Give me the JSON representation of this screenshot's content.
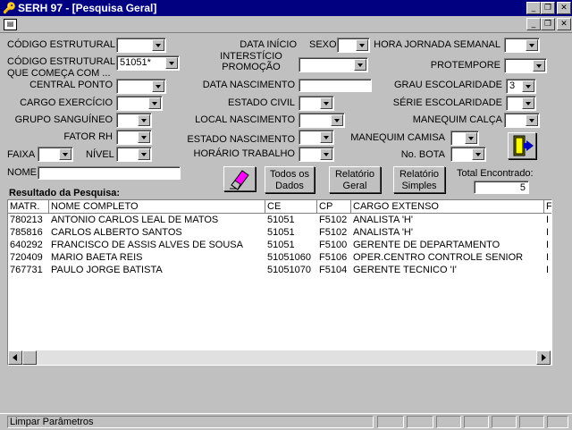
{
  "window": {
    "title": "SERH 97 - [Pesquisa Geral]"
  },
  "form": {
    "codigo_estrutural": {
      "label": "CÓDIGO ESTRUTURAL",
      "value": ""
    },
    "codigo_estrutural_comeca": {
      "label_line1": "CÓDIGO ESTRUTURAL",
      "label_line2": "QUE COMEÇA COM ...",
      "value": "51051*"
    },
    "central_ponto": {
      "label": "CENTRAL PONTO",
      "value": ""
    },
    "cargo_exercicio": {
      "label": "CARGO EXERCÍCIO",
      "value": ""
    },
    "grupo_sanguineo": {
      "label": "GRUPO SANGUÍNEO",
      "value": ""
    },
    "fator_rh": {
      "label": "FATOR RH",
      "value": ""
    },
    "faixa": {
      "label": "FAIXA",
      "value": ""
    },
    "nivel": {
      "label": "NÍVEL",
      "value": ""
    },
    "nome": {
      "label": "NOME",
      "value": ""
    },
    "data_inicio": {
      "label": "DATA INÍCIO"
    },
    "sexo": {
      "label": "SEXO",
      "value": ""
    },
    "intersticio": {
      "label_line1": "INTERSTÍCIO",
      "label_line2": "PROMOÇÃO",
      "value": ""
    },
    "data_nascimento": {
      "label": "DATA NASCIMENTO",
      "value": ""
    },
    "estado_civil": {
      "label": "ESTADO CIVIL",
      "value": ""
    },
    "local_nascimento": {
      "label": "LOCAL NASCIMENTO",
      "value": ""
    },
    "estado_nascimento": {
      "label": "ESTADO NASCIMENTO",
      "value": ""
    },
    "horario_trabalho": {
      "label": "HORÁRIO TRABALHO",
      "value": ""
    },
    "hora_jornada_semanal": {
      "label": "HORA JORNADA SEMANAL",
      "value": ""
    },
    "protempore": {
      "label": "PROTEMPORE",
      "value": ""
    },
    "grau_escolaridade": {
      "label": "GRAU ESCOLARIDADE",
      "value": "3"
    },
    "serie_escolaridade": {
      "label": "SÉRIE ESCOLARIDADE",
      "value": ""
    },
    "manequim_calca": {
      "label": "MANEQUIM CALÇA",
      "value": ""
    },
    "manequim_camisa": {
      "label": "MANEQUIM CAMISA",
      "value": ""
    },
    "no_bota": {
      "label": "No. BOTA",
      "value": ""
    }
  },
  "buttons": {
    "todos_line1": "Todos os",
    "todos_line2": "Dados",
    "rel_geral_line1": "Relatório",
    "rel_geral_line2": "Geral",
    "rel_simples_line1": "Relatório",
    "rel_simples_line2": "Simples",
    "clear_icon": "eraser-icon",
    "exit_icon": "exit-door-icon"
  },
  "total": {
    "label": "Total Encontrado:",
    "value": "5"
  },
  "results": {
    "label": "Resultado da Pesquisa:",
    "columns": [
      "MATR.",
      "NOME COMPLETO",
      "CE",
      "CP",
      "CARGO EXTENSO",
      "F"
    ],
    "rows": [
      [
        "780213",
        "ANTONIO CARLOS LEAL DE MATOS",
        "51051",
        "F5102",
        "ANALISTA 'H'",
        "I"
      ],
      [
        "785816",
        "CARLOS ALBERTO SANTOS",
        "51051",
        "F5102",
        "ANALISTA 'H'",
        "I"
      ],
      [
        "640292",
        "FRANCISCO DE ASSIS ALVES DE SOUSA",
        "51051",
        "F5100",
        "GERENTE DE DEPARTAMENTO",
        "I"
      ],
      [
        "720409",
        "MARIO BAETA REIS",
        "51051060",
        "F5106",
        "OPER.CENTRO CONTROLE SENIOR",
        "I"
      ],
      [
        "767731",
        "PAULO JORGE BATISTA",
        "51051070",
        "F5104",
        "GERENTE TECNICO 'I'",
        "I"
      ]
    ]
  },
  "status": {
    "text": "Limpar Parâmetros"
  },
  "colors": {
    "titlebar": "#000080",
    "face": "#c0c0c0"
  }
}
